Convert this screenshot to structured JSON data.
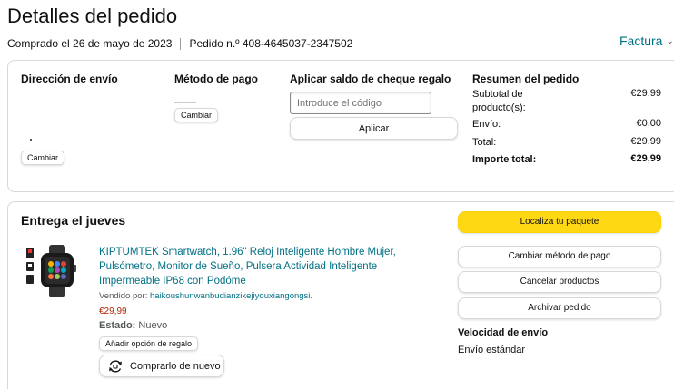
{
  "header": {
    "title": "Detalles del pedido",
    "ordered_on": "Comprado el 26 de mayo de 2023",
    "order_number": "Pedido n.º 408-4645037-2347502",
    "invoice_label": "Factura"
  },
  "shipping": {
    "heading": "Dirección de envío",
    "change_label": "Cambiar"
  },
  "payment": {
    "heading": "Método de pago",
    "change_label": "Cambiar"
  },
  "gift_card": {
    "heading": "Aplicar saldo de cheque regalo",
    "placeholder": "Introduce el código",
    "apply_label": "Aplicar"
  },
  "summary": {
    "heading": "Resumen del pedido",
    "rows": [
      {
        "label": "Subtotal de producto(s):",
        "value": "€29,99"
      },
      {
        "label": "Envío:",
        "value": "€0,00"
      },
      {
        "label": "Total:",
        "value": "€29,99"
      },
      {
        "label": "Importe total:",
        "value": "€29,99"
      }
    ]
  },
  "delivery": {
    "heading": "Entrega el jueves",
    "product_title": "KIPTUMTEK Smartwatch, 1.96\" Reloj Inteligente Hombre Mujer, Pulsómetro, Monitor de Sueño, Pulsera Actividad Inteligente Impermeable IP68 con Podóme",
    "seller_prefix": "Vendido por:",
    "seller_name": "haikoushunwanbudianzikejiyouxiangongsi.",
    "price": "€29,99",
    "state_label": "Estado:",
    "state_value": "Nuevo",
    "gift_option_label": "Añadir opción de regalo",
    "rebuy_label": "Comprarlo de nuevo"
  },
  "actions": [
    {
      "label": "Localiza tu paquete"
    },
    {
      "label": "Cambiar método de pago"
    },
    {
      "label": "Cancelar productos"
    },
    {
      "label": "Archivar pedido"
    }
  ],
  "shipping_speed": {
    "heading": "Velocidad de envío",
    "value": "Envío estándar"
  },
  "colors": {
    "link": "#007185",
    "primary_button": "#ffd814",
    "price": "#b12704"
  }
}
